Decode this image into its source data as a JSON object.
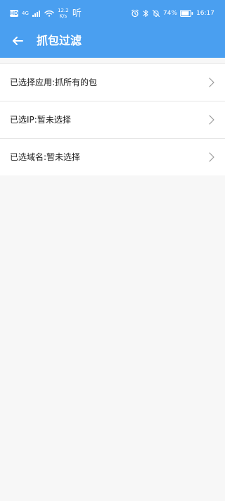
{
  "status_bar": {
    "hd": "HD",
    "network_type": "4G",
    "speed_value": "12.2",
    "speed_unit": "K/s",
    "listen_text": "听",
    "battery_percent": "74%",
    "clock": "16:17"
  },
  "header": {
    "title": "抓包过滤"
  },
  "list": {
    "items": [
      {
        "label": "已选择应用:抓所有的包"
      },
      {
        "label": "已选IP:暂未选择"
      },
      {
        "label": "已选域名:暂未选择"
      }
    ]
  },
  "colors": {
    "primary": "#4a9ff0",
    "background": "#f7f7f7",
    "card": "#ffffff",
    "divider": "#e6e6e6",
    "text": "#222222"
  },
  "icons": {
    "back": "arrow-left-icon",
    "chevron": "chevron-right-icon"
  }
}
